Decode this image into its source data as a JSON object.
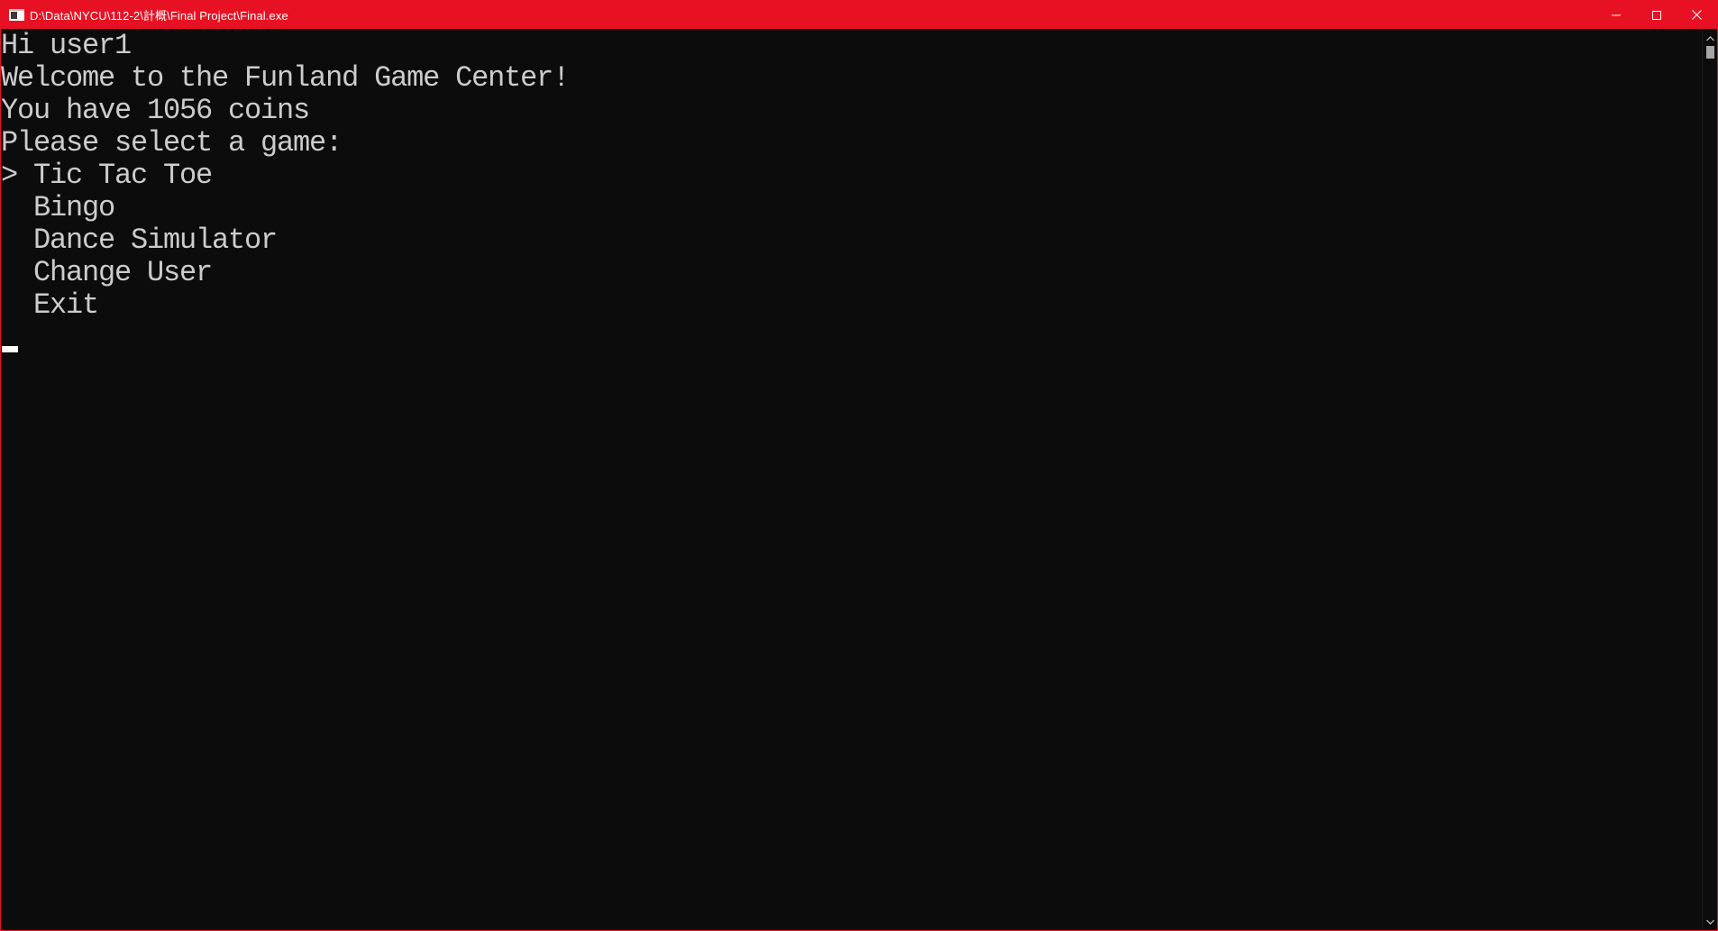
{
  "window": {
    "title": "D:\\Data\\NYCU\\112-2\\計概\\Final Project\\Final.exe",
    "accent_color": "#e81123",
    "icons": {
      "app": "console-app-icon",
      "minimize": "minimize-icon",
      "maximize": "maximize-icon",
      "close": "close-icon"
    }
  },
  "console": {
    "background": "#0c0c0c",
    "foreground": "#cccccc",
    "lines": {
      "greeting": "Hi user1",
      "welcome": "Welcome to the Funland Game Center!",
      "coins": "You have 1056 coins",
      "prompt": "Please select a game:"
    },
    "menu": {
      "pointer": ">",
      "items": [
        "Tic Tac Toe",
        "Bingo",
        "Dance Simulator",
        "Change User",
        "Exit"
      ],
      "selected_index": 0
    }
  }
}
